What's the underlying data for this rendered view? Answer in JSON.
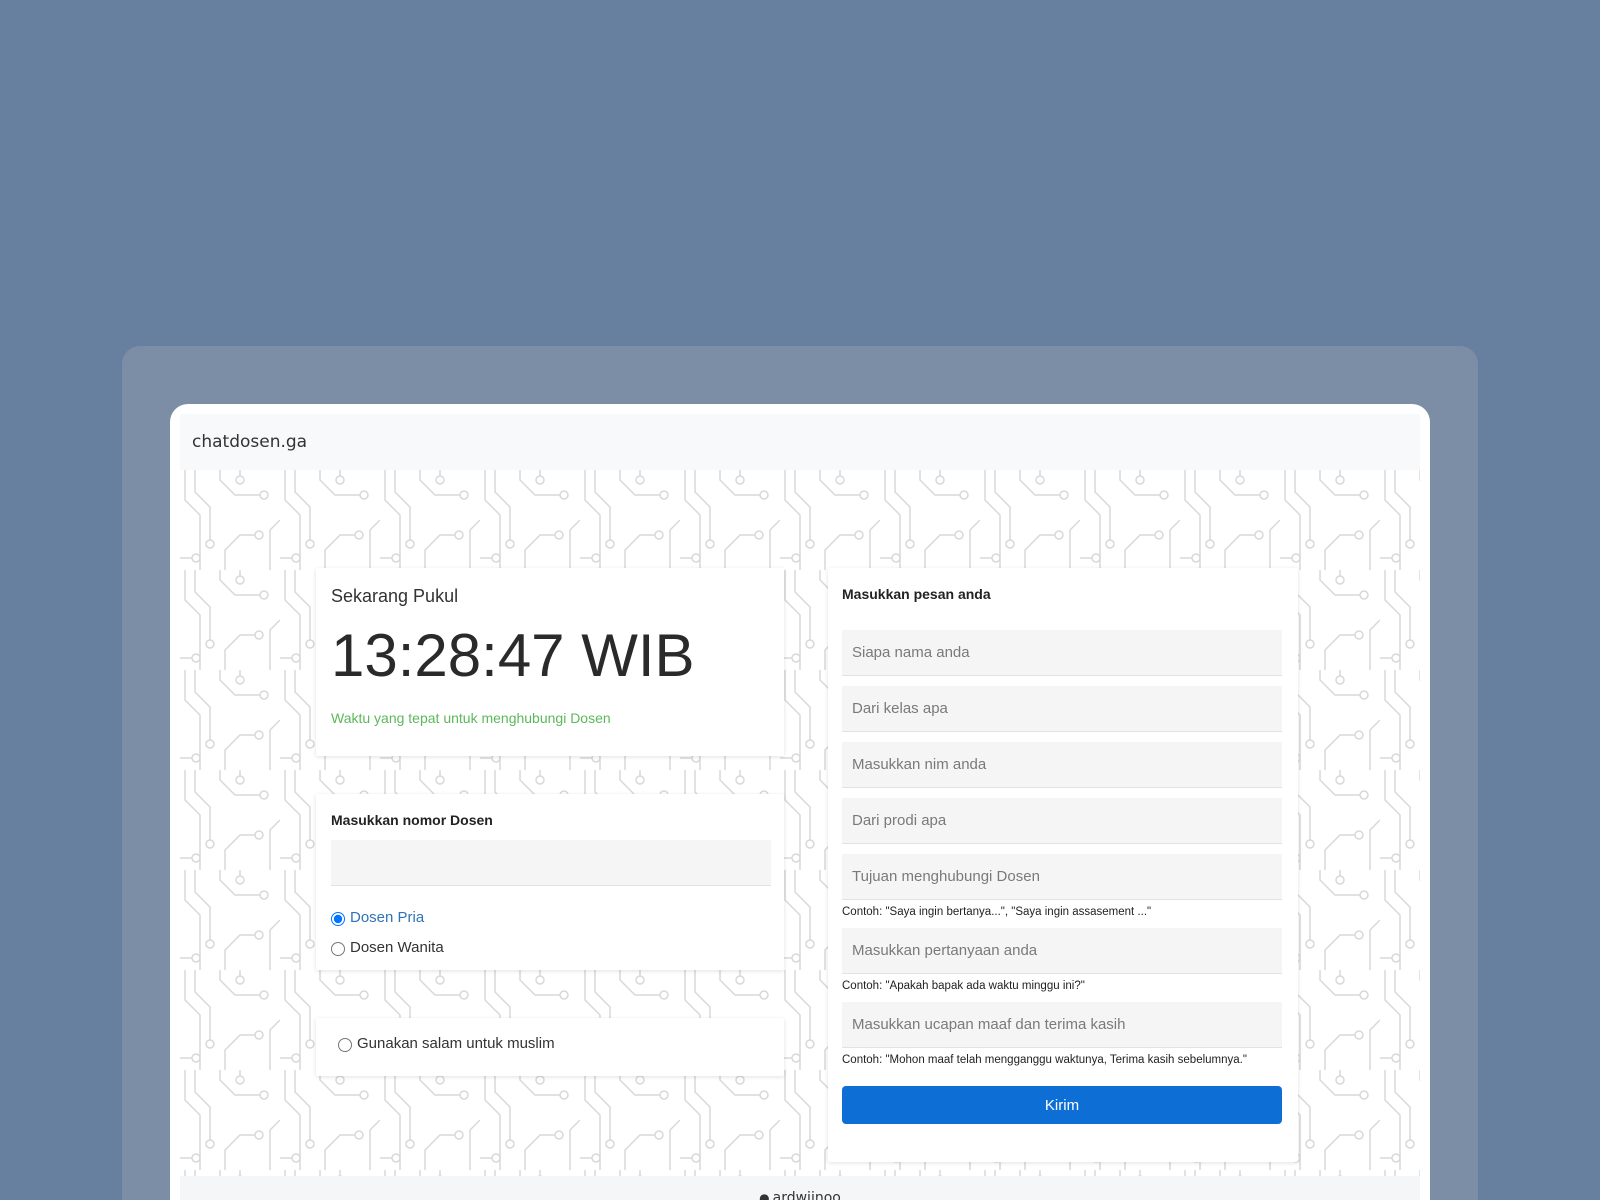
{
  "navbar": {
    "brand": "chatdosen.ga"
  },
  "clock": {
    "label": "Sekarang Pukul",
    "time": "13:28:47 WIB",
    "hint": "Waktu yang tepat untuk menghubungi Dosen",
    "hint_color": "#5cb85c"
  },
  "dosen": {
    "title": "Masukkan nomor Dosen",
    "input_value": "",
    "options": [
      {
        "label": "Dosen Pria",
        "selected": true
      },
      {
        "label": "Dosen Wanita",
        "selected": false
      }
    ]
  },
  "salam": {
    "label": "Gunakan salam untuk muslim",
    "selected": false
  },
  "message": {
    "title": "Masukkan pesan anda",
    "fields": [
      {
        "placeholder": "Siapa nama anda",
        "value": ""
      },
      {
        "placeholder": "Dari kelas apa",
        "value": ""
      },
      {
        "placeholder": "Masukkan nim anda",
        "value": ""
      },
      {
        "placeholder": "Dari prodi apa",
        "value": ""
      },
      {
        "placeholder": "Tujuan menghubungi Dosen",
        "value": "",
        "hint": "Contoh: \"Saya ingin bertanya...\", \"Saya ingin assasement ...\""
      },
      {
        "placeholder": "Masukkan pertanyaan anda",
        "value": "",
        "hint": "Contoh: \"Apakah bapak ada waktu minggu ini?\""
      },
      {
        "placeholder": "Masukkan ucapan maaf dan terima kasih",
        "value": "",
        "hint": "Contoh: \"Mohon maaf telah mengganggu waktunya, Terima kasih sebelumnya.\""
      }
    ],
    "submit_label": "Kirim",
    "submit_color": "#0d6fd6"
  },
  "footer": {
    "icon": "github-icon",
    "author": "ardwiinoo"
  },
  "colors": {
    "background": "#68809f",
    "frame": "#7c8ea6"
  }
}
